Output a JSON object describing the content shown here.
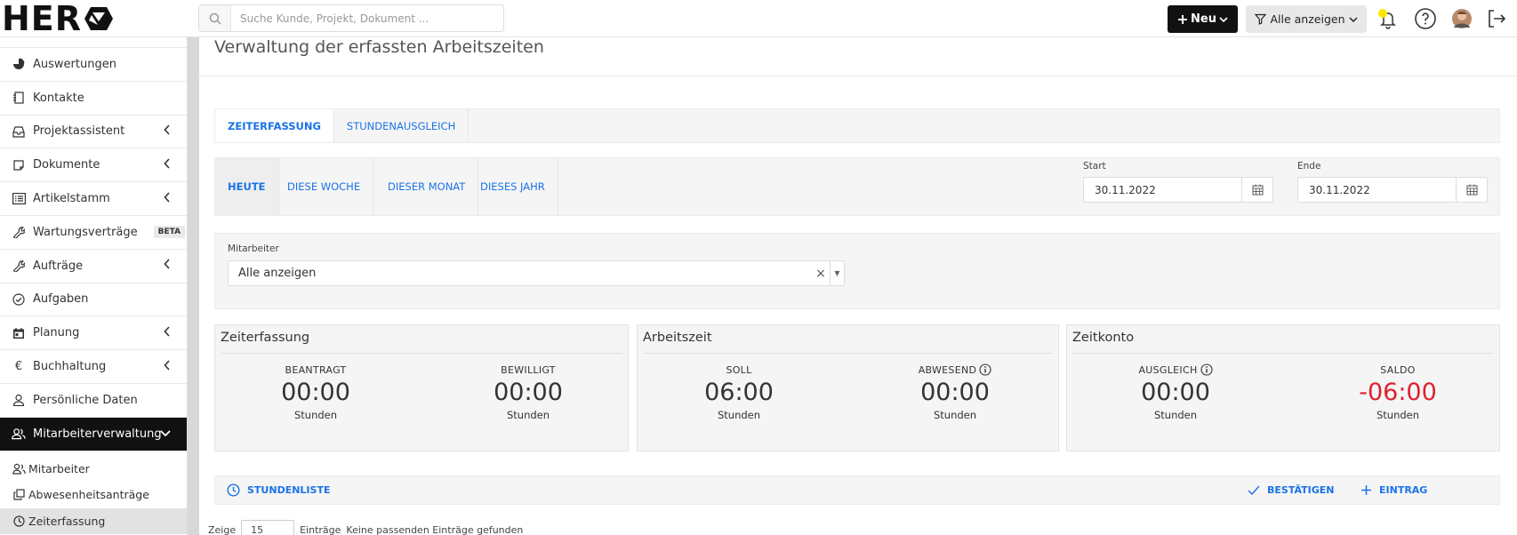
{
  "brand": {
    "logo_text": "HER"
  },
  "search": {
    "placeholder": "Suche Kunde, Projekt, Dokument ..."
  },
  "topbar": {
    "new_label": "Neu",
    "filter_label": "Alle anzeigen"
  },
  "sidebar": {
    "items": [
      {
        "label": "Auswertungen",
        "icon": "pie-chart-icon"
      },
      {
        "label": "Kontakte",
        "icon": "contacts-book-icon"
      },
      {
        "label": "Projektassistent",
        "icon": "inbox-icon",
        "expandable": true
      },
      {
        "label": "Dokumente",
        "icon": "note-icon",
        "expandable": true
      },
      {
        "label": "Artikelstamm",
        "icon": "list-icon",
        "expandable": true
      },
      {
        "label": "Wartungsverträge",
        "icon": "wrench-icon",
        "badge": "BETA"
      },
      {
        "label": "Aufträge",
        "icon": "wrench-icon",
        "expandable": true
      },
      {
        "label": "Aufgaben",
        "icon": "check-circle-icon"
      },
      {
        "label": "Planung",
        "icon": "calendar-icon",
        "expandable": true
      },
      {
        "label": "Buchhaltung",
        "icon": "euro-icon",
        "expandable": true
      },
      {
        "label": "Persönliche Daten",
        "icon": "user-icon"
      },
      {
        "label": "Mitarbeiterverwaltung",
        "icon": "users-icon",
        "expanded": true
      }
    ],
    "subitems": [
      {
        "label": "Mitarbeiter",
        "icon": "users-icon"
      },
      {
        "label": "Abwesenheitsanträge",
        "icon": "copy-icon"
      },
      {
        "label": "Zeiterfassung",
        "icon": "clock-icon"
      }
    ]
  },
  "page": {
    "title": "Verwaltung der erfassten Arbeitszeiten"
  },
  "tabs": [
    {
      "label": "ZEITERFASSUNG",
      "active": true
    },
    {
      "label": "STUNDENAUSGLEICH",
      "active": false
    }
  ],
  "period_tabs": [
    {
      "label": "HEUTE",
      "active": true
    },
    {
      "label": "DIESE WOCHE",
      "active": false
    },
    {
      "label": "DIESER MONAT",
      "active": false
    },
    {
      "label": "DIESES JAHR",
      "active": false
    }
  ],
  "dates": {
    "start_label": "Start",
    "start_value": "30.11.2022",
    "end_label": "Ende",
    "end_value": "30.11.2022"
  },
  "employee_filter": {
    "label": "Mitarbeiter",
    "value": "Alle anzeigen"
  },
  "cards": {
    "zeiterfassung": {
      "title": "Zeiterfassung",
      "left": {
        "label": "BEANTRAGT",
        "value": "00:00",
        "unit": "Stunden"
      },
      "right": {
        "label": "BEWILLIGT",
        "value": "00:00",
        "unit": "Stunden"
      }
    },
    "arbeitszeit": {
      "title": "Arbeitszeit",
      "left": {
        "label": "SOLL",
        "value": "06:00",
        "unit": "Stunden"
      },
      "right": {
        "label": "ABWESEND",
        "value": "00:00",
        "unit": "Stunden"
      }
    },
    "zeitkonto": {
      "title": "Zeitkonto",
      "left": {
        "label": "AUSGLEICH",
        "value": "00:00",
        "unit": "Stunden"
      },
      "right": {
        "label": "SALDO",
        "value": "-06:00",
        "unit": "Stunden"
      }
    }
  },
  "list": {
    "title": "STUNDENLISTE",
    "confirm_label": "BESTÄTIGEN",
    "entry_label": "EINTRAG"
  },
  "table_controls": {
    "show_label": "Zeige",
    "page_size": "15",
    "entries_label": "Einträge",
    "empty_text": "Keine passenden Einträge gefunden"
  },
  "colors": {
    "accent": "#1a73e8",
    "negative": "#e0212e",
    "dark": "#111111"
  }
}
